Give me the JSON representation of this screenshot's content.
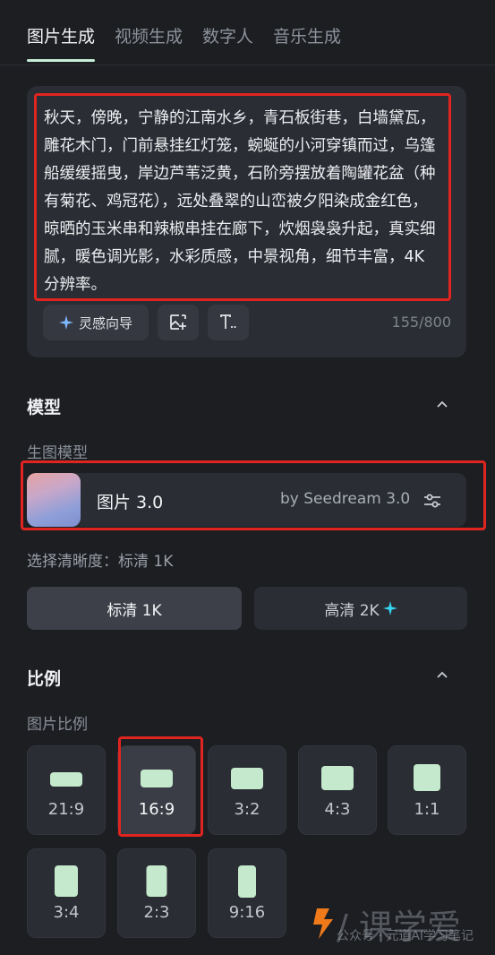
{
  "tabs": [
    {
      "label": "图片生成",
      "active": true
    },
    {
      "label": "视频生成",
      "active": false
    },
    {
      "label": "数字人",
      "active": false
    },
    {
      "label": "音乐生成",
      "active": false
    }
  ],
  "prompt": {
    "text": "秋天，傍晚，宁静的江南水乡，青石板街巷，白墙黛瓦，雕花木门，门前悬挂红灯笼，蜿蜒的小河穿镇而过，乌篷船缓缓摇曳，岸边芦苇泛黄，石阶旁摆放着陶罐花盆（种有菊花、鸡冠花），远处叠翠的山峦被夕阳染成金红色，晾晒的玉米串和辣椒串挂在廊下，炊烟袅袅升起，真实细腻，暖色调光影，水彩质感，中景视角，细节丰富，4K 分辨率。",
    "inspire_label": "灵感向导",
    "char_count": "155/800"
  },
  "model_section": {
    "title": "模型",
    "sub_label": "生图模型",
    "model_name": "图片 3.0",
    "model_by": "by Seedream 3.0"
  },
  "resolution": {
    "label": "选择清晰度：标清 1K",
    "options": [
      {
        "label": "标清 1K",
        "selected": true
      },
      {
        "label": "高清 2K",
        "selected": false
      }
    ]
  },
  "ratio_section": {
    "title": "比例",
    "sub_label": "图片比例",
    "options": [
      {
        "label": "21:9",
        "selected": false
      },
      {
        "label": "16:9",
        "selected": true
      },
      {
        "label": "3:2",
        "selected": false
      },
      {
        "label": "4:3",
        "selected": false
      },
      {
        "label": "1:1",
        "selected": false
      },
      {
        "label": "3:4",
        "selected": false
      },
      {
        "label": "2:3",
        "selected": false
      },
      {
        "label": "9:16",
        "selected": false
      }
    ]
  },
  "watermark": {
    "text": "公众号 · 元道AI学习笔记"
  },
  "colors": {
    "background": "#1c1e22",
    "card": "#2a2d33",
    "accent_green": "#c4e9cd",
    "highlight_red": "#e02520",
    "sparkle_cyan": "#35d6f2"
  }
}
